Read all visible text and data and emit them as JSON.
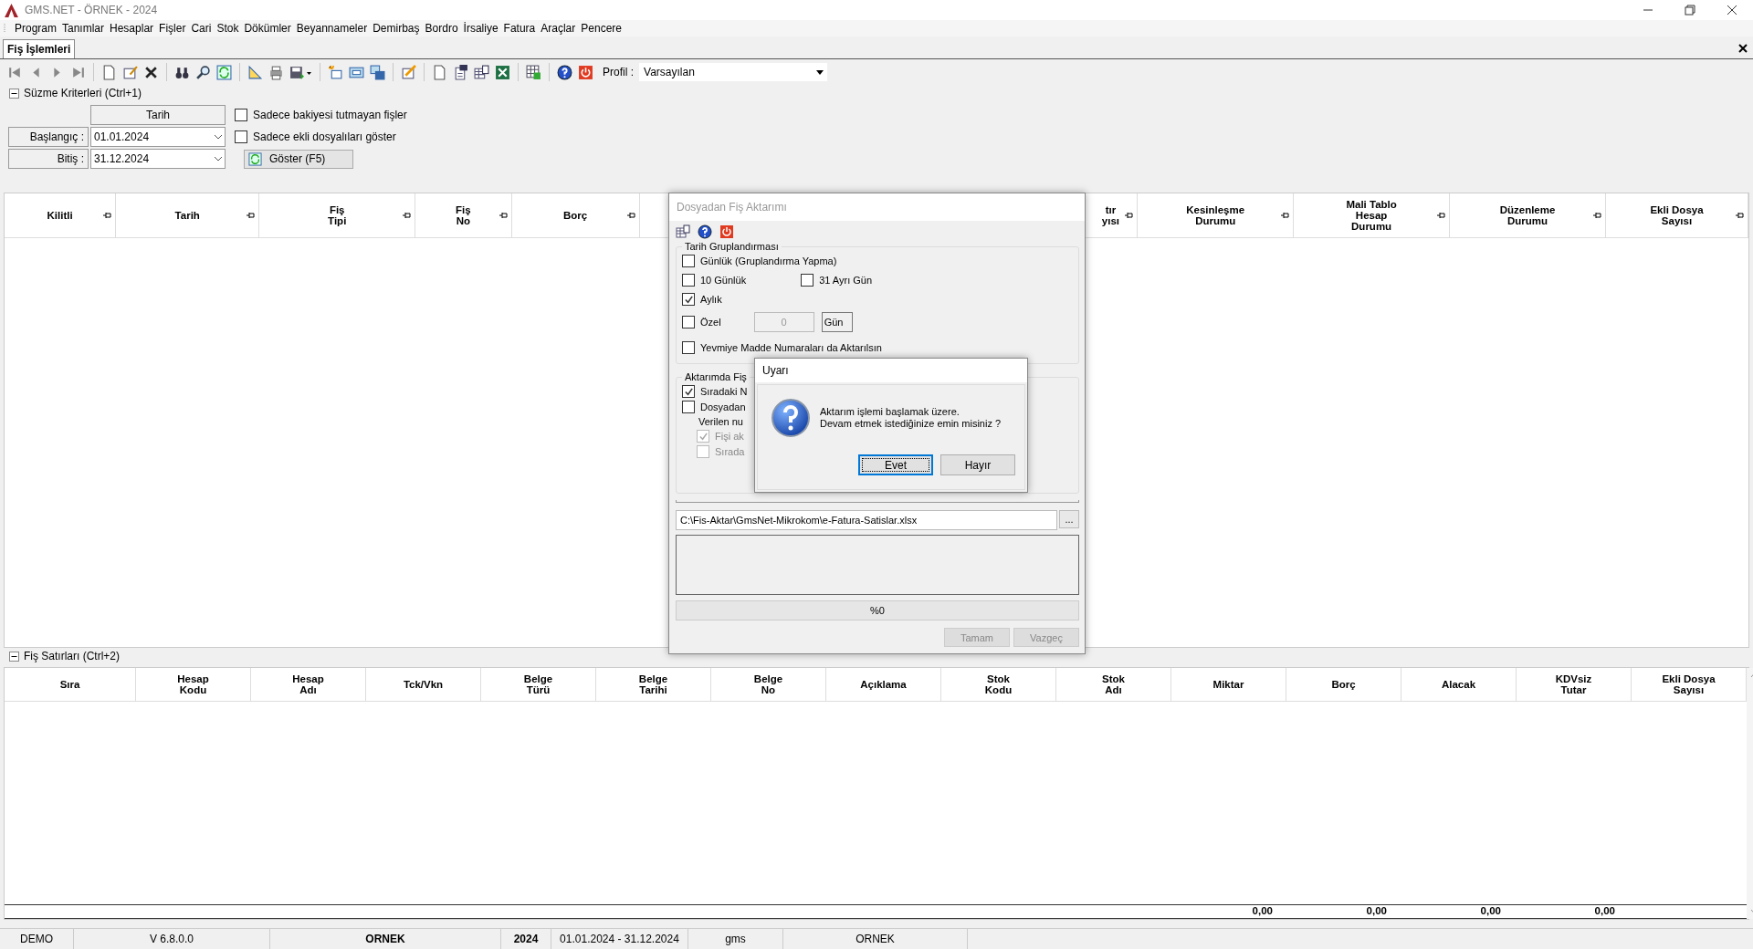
{
  "window": {
    "title": "GMS.NET - ÖRNEK - 2024"
  },
  "menu": [
    "Program",
    "Tanımlar",
    "Hesaplar",
    "Fişler",
    "Cari",
    "Stok",
    "Dökümler",
    "Beyannameler",
    "Demirbaş",
    "Bordro",
    "İrsaliye",
    "Fatura",
    "Araçlar",
    "Pencere"
  ],
  "tabs": [
    {
      "label": "Fiş İşlemleri",
      "selected": true
    }
  ],
  "toolbar": {
    "profile_label": "Profil :",
    "profile_value": "Varsayılan"
  },
  "filter": {
    "title": "Süzme Kriterleri (Ctrl+1)",
    "expanded": true,
    "date_header": "Tarih",
    "start": {
      "label": "Başlangıç :",
      "value": "01.01.2024"
    },
    "end": {
      "label": "Bitiş :",
      "value": "31.12.2024"
    },
    "checkboxes": [
      {
        "label": "Sadece bakiyesi tutmayan fişler",
        "checked": false
      },
      {
        "label": "Sadece ekli dosyalıları göster",
        "checked": false
      }
    ],
    "show_button": "Göster (F5)"
  },
  "top_table": {
    "columns": [
      {
        "label": "Kilitli"
      },
      {
        "label": "Tarih"
      },
      {
        "label": "Fiş\nTipi"
      },
      {
        "label": "Fiş\nNo"
      },
      {
        "label": "Borç"
      },
      {
        "label": "tır\nyısı",
        "kind": "partial"
      },
      {
        "label": "Kesinleşme\nDurumu"
      },
      {
        "label": "Mali Tablo\nHesap\nDurumu"
      },
      {
        "label": "Düzenleme\nDurumu"
      },
      {
        "label": "Ekli Dosya\nSayısı"
      }
    ]
  },
  "lines": {
    "title": "Fiş Satırları (Ctrl+2)",
    "expanded": true,
    "columns": [
      {
        "label": "Sıra"
      },
      {
        "label": "Hesap\nKodu"
      },
      {
        "label": "Hesap\nAdı"
      },
      {
        "label": "Tck/Vkn"
      },
      {
        "label": "Belge\nTürü"
      },
      {
        "label": "Belge\nTarihi"
      },
      {
        "label": "Belge\nNo"
      },
      {
        "label": "Açıklama"
      },
      {
        "label": "Stok\nKodu"
      },
      {
        "label": "Stok\nAdı"
      },
      {
        "label": "Miktar",
        "total": "0,00"
      },
      {
        "label": "Borç",
        "total": "0,00"
      },
      {
        "label": "Alacak",
        "total": "0,00"
      },
      {
        "label": "KDVsiz\nTutar",
        "total": "0,00"
      },
      {
        "label": "Ekli Dosya\nSayısı"
      }
    ]
  },
  "status_bar": [
    {
      "text": "DEMO",
      "bold": false
    },
    {
      "text": "V 6.8.0.0",
      "bold": false
    },
    {
      "text": "ORNEK",
      "bold": true
    },
    {
      "text": "2024",
      "bold": true
    },
    {
      "text": "01.01.2024 - 31.12.2024",
      "bold": false
    },
    {
      "text": "gms",
      "bold": false
    },
    {
      "text": "ORNEK",
      "bold": false
    }
  ],
  "import_dialog": {
    "title": "Dosyadan Fiş Aktarımı",
    "active": false,
    "date_group": {
      "title": "Tarih Gruplandırması",
      "rows": [
        [
          {
            "kind": "check",
            "label": "Günlük (Gruplandırma Yapma)",
            "checked": false
          }
        ],
        [
          {
            "kind": "check",
            "label": "10 Günlük",
            "checked": false
          },
          {
            "kind": "check",
            "label": "31 Ayrı Gün",
            "checked": false
          }
        ],
        [
          {
            "kind": "check",
            "label": "Aylık",
            "checked": true
          }
        ],
        [
          {
            "kind": "days",
            "label": "Özel",
            "checked": false,
            "value": "0",
            "unit": "Gün",
            "disabled": true
          }
        ],
        [
          {
            "kind": "check",
            "label": "Yevmiye Madde Numaraları da Aktarılsın",
            "checked": false
          }
        ]
      ]
    },
    "number_group": {
      "title": "Aktarımda Fiş",
      "items": [
        {
          "kind": "check",
          "label": "Sıradaki N",
          "checked": true,
          "disabled": false
        },
        {
          "kind": "check",
          "label": "Dosyadan",
          "checked": false,
          "disabled": false
        },
        {
          "kind": "text",
          "label": "Verilen nu"
        },
        {
          "kind": "subcheck",
          "label": "Fişi ak",
          "checked": true,
          "disabled": true
        },
        {
          "kind": "subcheck",
          "label": "Sırada",
          "checked": false,
          "disabled": true
        }
      ]
    },
    "file_path": "C:\\Fis-Aktar\\GmsNet-Mikrokom\\e-Fatura-Satislar.xlsx",
    "browse_button": "...",
    "progress": {
      "level": 0,
      "text": "%0"
    },
    "buttons": [
      {
        "label": "Tamam",
        "disabled": true
      },
      {
        "label": "Vazgeç",
        "disabled": true
      }
    ]
  },
  "confirm_dialog": {
    "title": "Uyarı",
    "message": "Aktarım işlemi başlamak üzere.\nDevam etmek istediğinize emin misiniz ?",
    "buttons": [
      {
        "label": "Evet",
        "selected": true
      },
      {
        "label": "Hayır",
        "selected": false
      }
    ]
  }
}
